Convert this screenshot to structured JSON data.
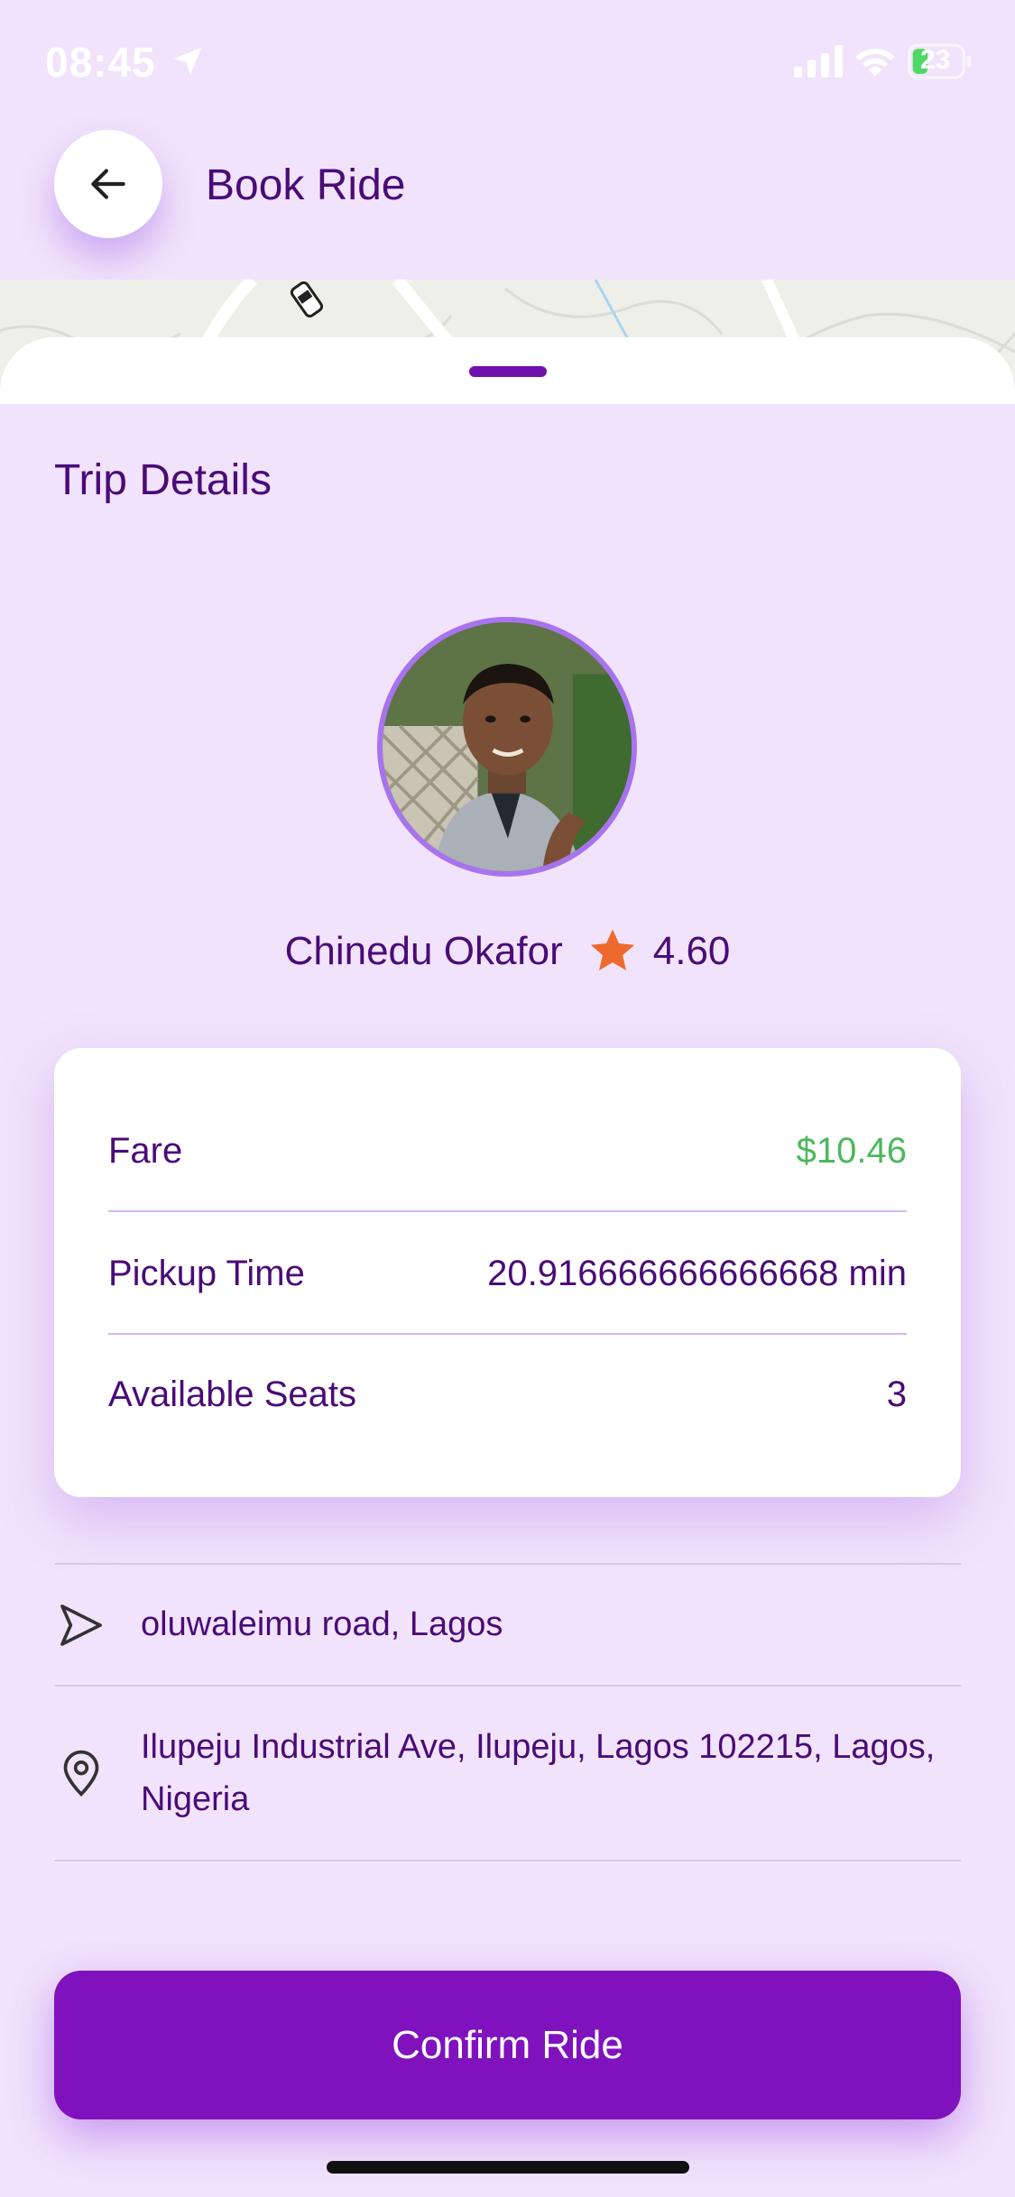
{
  "status_bar": {
    "time": "08:45",
    "battery": "23"
  },
  "header": {
    "title": "Book Ride",
    "back_icon": "arrow-left-icon"
  },
  "trip": {
    "section_title": "Trip Details",
    "driver_name": "Chinedu Okafor",
    "rating": "4.60",
    "rating_icon": "star-icon",
    "rating_color": "#ee6a2c"
  },
  "details": {
    "rows": [
      {
        "label": "Fare",
        "value": "$10.46"
      },
      {
        "label": "Pickup Time",
        "value": "20.916666666666668 min"
      },
      {
        "label": "Available Seats",
        "value": "3"
      }
    ],
    "fare_color": "#4cb85c"
  },
  "route": {
    "origin": "oluwaleimu road, Lagos",
    "destination": "Ilupeju Industrial Ave, Ilupeju, Lagos 102215, Lagos, Nigeria",
    "origin_icon": "navigation-arrow-icon",
    "destination_icon": "map-pin-icon"
  },
  "actions": {
    "confirm_label": "Confirm Ride"
  },
  "colors": {
    "background": "#f1e3fb",
    "primary": "#7f12bd",
    "text": "#4a0b78"
  }
}
